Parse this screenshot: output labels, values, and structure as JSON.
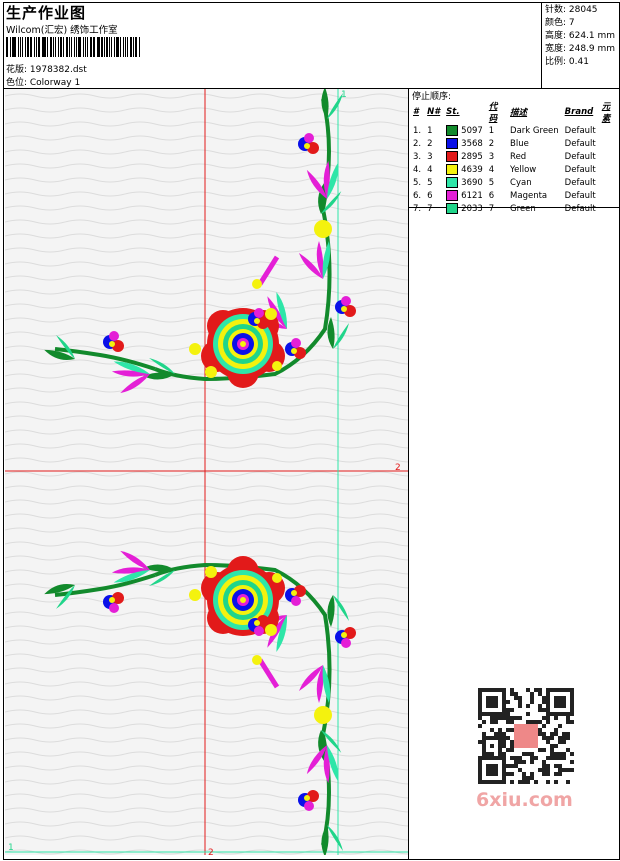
{
  "header": {
    "title": "生产作业图",
    "subtitle": "Wilcom(汇宏) 绣饰工作室",
    "design_label": "花版: 1978382.dst",
    "colorway_label": "色位: Colorway 1"
  },
  "stats": {
    "stitches": "针数: 28045",
    "colors": "颜色: 7",
    "height": "高度: 624.1 mm",
    "width": "宽度: 248.9 mm",
    "scale": "比例: 0.41"
  },
  "stop_sequence": {
    "title": "停止顺序:",
    "headers": [
      "#",
      "N#",
      "St.",
      "代码",
      "描述",
      "Brand",
      "元素"
    ],
    "rows": [
      {
        "num": "1.",
        "n": "1",
        "color": "#128A2C",
        "st": "5097",
        "code": "1",
        "desc": "Dark Green",
        "brand": "Default"
      },
      {
        "num": "2.",
        "n": "2",
        "color": "#0A10E8",
        "st": "3568",
        "code": "2",
        "desc": "Blue",
        "brand": "Default"
      },
      {
        "num": "3.",
        "n": "3",
        "color": "#E21A1A",
        "st": "2895",
        "code": "3",
        "desc": "Red",
        "brand": "Default"
      },
      {
        "num": "4.",
        "n": "4",
        "color": "#F4F20E",
        "st": "4639",
        "code": "4",
        "desc": "Yellow",
        "brand": "Default"
      },
      {
        "num": "5.",
        "n": "5",
        "color": "#2EE6A8",
        "st": "3690",
        "code": "5",
        "desc": "Cyan",
        "brand": "Default"
      },
      {
        "num": "6.",
        "n": "6",
        "color": "#E41FD6",
        "st": "6121",
        "code": "6",
        "desc": "Magenta",
        "brand": "Default"
      },
      {
        "num": "7.",
        "n": "7",
        "color": "#20D58A",
        "st": "2033",
        "code": "7",
        "desc": "Green",
        "brand": "Default"
      }
    ]
  },
  "design": {
    "guide_labels": {
      "v1": "1",
      "h2": "2",
      "h1": "1",
      "v2": "2"
    }
  },
  "watermark": {
    "text": "6xiu.com"
  }
}
